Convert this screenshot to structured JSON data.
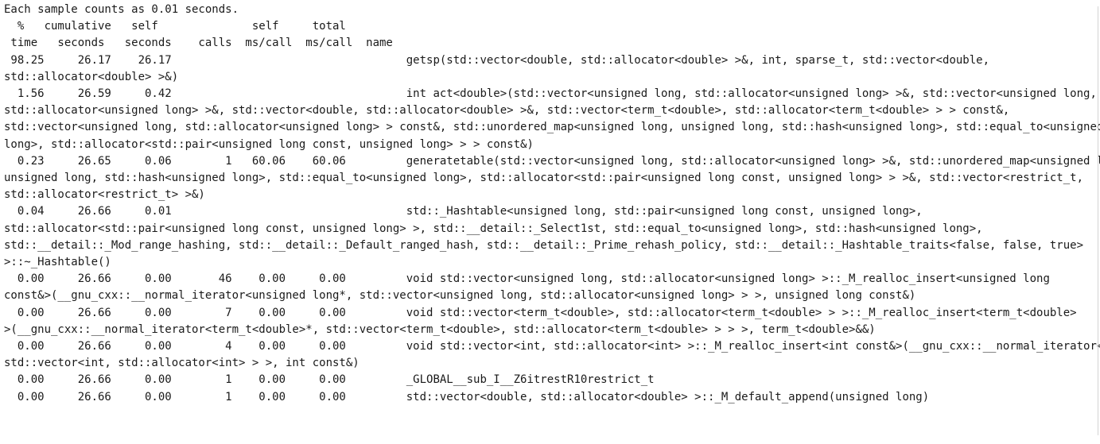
{
  "profile": {
    "header_line": "Each sample counts as 0.01 seconds.",
    "column_header_1": "  %   cumulative   self              self     total           ",
    "column_header_2": " time   seconds   seconds    calls  ms/call  ms/call  name    ",
    "rows": [
      {
        "pct_time": "98.25",
        "cumulative_seconds": "26.17",
        "self_seconds": "26.17",
        "calls": "",
        "self_ms_per_call": "",
        "total_ms_per_call": "",
        "name": "getsp(std::vector<double, std::allocator<double> >&, int, sparse_t, std::vector<double, std::allocator<double> >&)"
      },
      {
        "pct_time": "1.56",
        "cumulative_seconds": "26.59",
        "self_seconds": "0.42",
        "calls": "",
        "self_ms_per_call": "",
        "total_ms_per_call": "",
        "name": "int act<double>(std::vector<unsigned long, std::allocator<unsigned long> >&, std::vector<unsigned long, std::allocator<unsigned long> >&, std::vector<double, std::allocator<double> >&, std::vector<term_t<double>, std::allocator<term_t<double> > > const&, std::vector<unsigned long, std::allocator<unsigned long> > const&, std::unordered_map<unsigned long, unsigned long, std::hash<unsigned long>, std::equal_to<unsigned long>, std::allocator<std::pair<unsigned long const, unsigned long> > > const&)"
      },
      {
        "pct_time": "0.23",
        "cumulative_seconds": "26.65",
        "self_seconds": "0.06",
        "calls": "1",
        "self_ms_per_call": "60.06",
        "total_ms_per_call": "60.06",
        "name": "generatetable(std::vector<unsigned long, std::allocator<unsigned long> >&, std::unordered_map<unsigned long, unsigned long, std::hash<unsigned long>, std::equal_to<unsigned long>, std::allocator<std::pair<unsigned long const, unsigned long> > >&, std::vector<restrict_t, std::allocator<restrict_t> >&)"
      },
      {
        "pct_time": "0.04",
        "cumulative_seconds": "26.66",
        "self_seconds": "0.01",
        "calls": "",
        "self_ms_per_call": "",
        "total_ms_per_call": "",
        "name": "std::_Hashtable<unsigned long, std::pair<unsigned long const, unsigned long>, std::allocator<std::pair<unsigned long const, unsigned long> >, std::__detail::_Select1st, std::equal_to<unsigned long>, std::hash<unsigned long>, std::__detail::_Mod_range_hashing, std::__detail::_Default_ranged_hash, std::__detail::_Prime_rehash_policy, std::__detail::_Hashtable_traits<false, false, true> >::~_Hashtable()"
      },
      {
        "pct_time": "0.00",
        "cumulative_seconds": "26.66",
        "self_seconds": "0.00",
        "calls": "46",
        "self_ms_per_call": "0.00",
        "total_ms_per_call": "0.00",
        "name": "void std::vector<unsigned long, std::allocator<unsigned long> >::_M_realloc_insert<unsigned long const&>(__gnu_cxx::__normal_iterator<unsigned long*, std::vector<unsigned long, std::allocator<unsigned long> > >, unsigned long const&)"
      },
      {
        "pct_time": "0.00",
        "cumulative_seconds": "26.66",
        "self_seconds": "0.00",
        "calls": "7",
        "self_ms_per_call": "0.00",
        "total_ms_per_call": "0.00",
        "name": "void std::vector<term_t<double>, std::allocator<term_t<double> > >::_M_realloc_insert<term_t<double> >(__gnu_cxx::__normal_iterator<term_t<double>*, std::vector<term_t<double>, std::allocator<term_t<double> > > >, term_t<double>&&)"
      },
      {
        "pct_time": "0.00",
        "cumulative_seconds": "26.66",
        "self_seconds": "0.00",
        "calls": "4",
        "self_ms_per_call": "0.00",
        "total_ms_per_call": "0.00",
        "name": "void std::vector<int, std::allocator<int> >::_M_realloc_insert<int const&>(__gnu_cxx::__normal_iterator<int*, std::vector<int, std::allocator<int> > >, int const&)"
      },
      {
        "pct_time": "0.00",
        "cumulative_seconds": "26.66",
        "self_seconds": "0.00",
        "calls": "1",
        "self_ms_per_call": "0.00",
        "total_ms_per_call": "0.00",
        "name": "_GLOBAL__sub_I__Z6itrestR10restrict_t"
      },
      {
        "pct_time": "0.00",
        "cumulative_seconds": "26.66",
        "self_seconds": "0.00",
        "calls": "1",
        "self_ms_per_call": "0.00",
        "total_ms_per_call": "0.00",
        "name": "std::vector<double, std::allocator<double> >::_M_default_append(unsigned long)"
      }
    ]
  }
}
